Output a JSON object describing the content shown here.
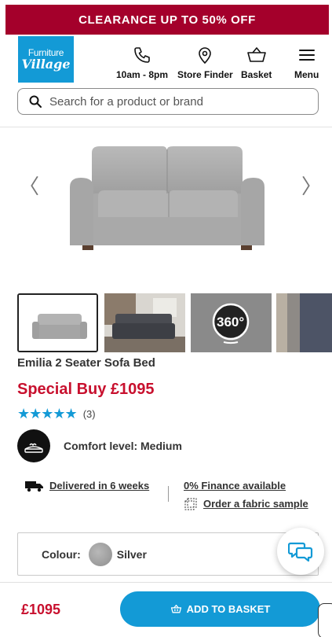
{
  "promo": {
    "text": "CLEARANCE UP TO 50% OFF"
  },
  "header": {
    "logo_line1": "Furniture",
    "logo_line2": "Village",
    "nav": [
      {
        "label": "10am - 8pm",
        "icon": "phone-icon"
      },
      {
        "label": "Store Finder",
        "icon": "location-pin-icon"
      },
      {
        "label": "Basket",
        "icon": "basket-icon"
      },
      {
        "label": "Menu",
        "icon": "hamburger-menu-icon"
      }
    ]
  },
  "search": {
    "placeholder": "Search for a product or brand",
    "value": ""
  },
  "gallery": {
    "prev_arrow": "〈",
    "next_arrow": "〉",
    "thumbnails": [
      "sofa-front-view",
      "sofa-room-scene",
      "360-view",
      "fabric-detail"
    ],
    "thumb_360_label": "360°"
  },
  "product": {
    "title": "Emilia 2 Seater Sofa Bed",
    "price_text": "Special Buy £1095",
    "stars": "★★★★★",
    "rating": 5,
    "review_count": "(3)",
    "comfort": "Comfort level: Medium"
  },
  "links": {
    "delivery": "Delivered in 6 weeks",
    "finance": "0% Finance available",
    "sample": "Order a fabric sample"
  },
  "colour": {
    "label": "Colour:",
    "value": "Silver"
  },
  "bottom": {
    "price": "£1095",
    "add_button": "ADD TO BASKET"
  },
  "colors": {
    "promo_bg": "#a4002b",
    "brand_blue": "#139ad6",
    "price_red": "#c8102e"
  }
}
